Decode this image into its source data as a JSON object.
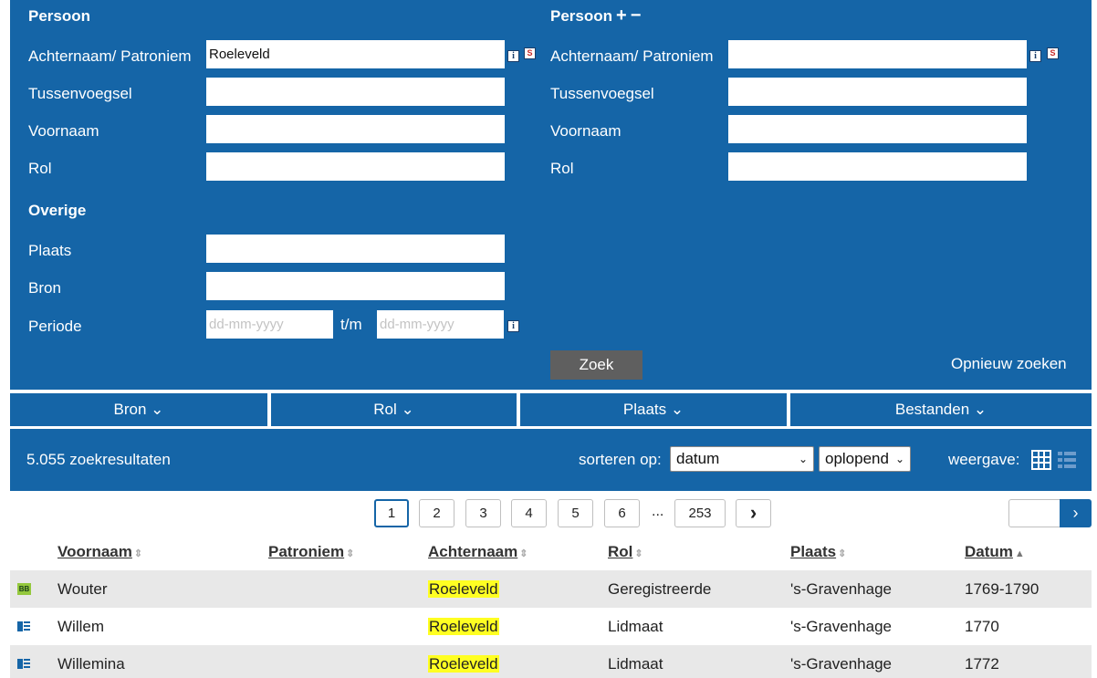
{
  "persoon1": {
    "heading": "Persoon",
    "achternaam_label": "Achternaam/ Patroniem",
    "achternaam_value": "Roeleveld",
    "tussenvoegsel_label": "Tussenvoegsel",
    "voornaam_label": "Voornaam",
    "rol_label": "Rol"
  },
  "persoon2": {
    "heading": "Persoon",
    "plus": "+",
    "minus": "−",
    "achternaam_label": "Achternaam/ Patroniem",
    "tussenvoegsel_label": "Tussenvoegsel",
    "voornaam_label": "Voornaam",
    "rol_label": "Rol"
  },
  "overige": {
    "heading": "Overige",
    "plaats_label": "Plaats",
    "bron_label": "Bron",
    "periode_label": "Periode",
    "date_placeholder": "dd-mm-yyyy",
    "tm_label": "t/m"
  },
  "icons": {
    "info": "i",
    "soundex": "S"
  },
  "actions": {
    "zoek": "Zoek",
    "opnieuw": "Opnieuw zoeken"
  },
  "filters": [
    {
      "label": "Bron ⌄"
    },
    {
      "label": "Rol ⌄"
    },
    {
      "label": "Plaats ⌄"
    },
    {
      "label": "Bestanden ⌄"
    }
  ],
  "results": {
    "count": "5.055  zoekresultaten",
    "sort_label": "sorteren op:",
    "sort_value": "datum",
    "order_value": "oplopend",
    "view_label": "weergave:"
  },
  "pagination": {
    "pages": [
      "1",
      "2",
      "3",
      "4",
      "5",
      "6"
    ],
    "ellipsis": "...",
    "last": "253",
    "next": "›"
  },
  "table": {
    "headers": {
      "voornaam": "Voornaam",
      "patroniem": "Patroniem",
      "achternaam": "Achternaam",
      "rol": "Rol",
      "plaats": "Plaats",
      "datum": "Datum"
    },
    "rows": [
      {
        "icon": "BB",
        "voornaam": "Wouter",
        "achternaam": "Roeleveld",
        "rol": "Geregistreerde",
        "plaats": "'s-Gravenhage",
        "datum": "1769-1790"
      },
      {
        "icon": "doc",
        "voornaam": "Willem",
        "achternaam": "Roeleveld",
        "rol": "Lidmaat",
        "plaats": "'s-Gravenhage",
        "datum": "1770"
      },
      {
        "icon": "doc",
        "voornaam": "Willemina",
        "achternaam": "Roeleveld",
        "rol": "Lidmaat",
        "plaats": "'s-Gravenhage",
        "datum": "1772"
      }
    ]
  },
  "colors": {
    "panel": "#1565a7",
    "highlight": "#ffff22",
    "zoek_button": "#5f5f5f"
  }
}
